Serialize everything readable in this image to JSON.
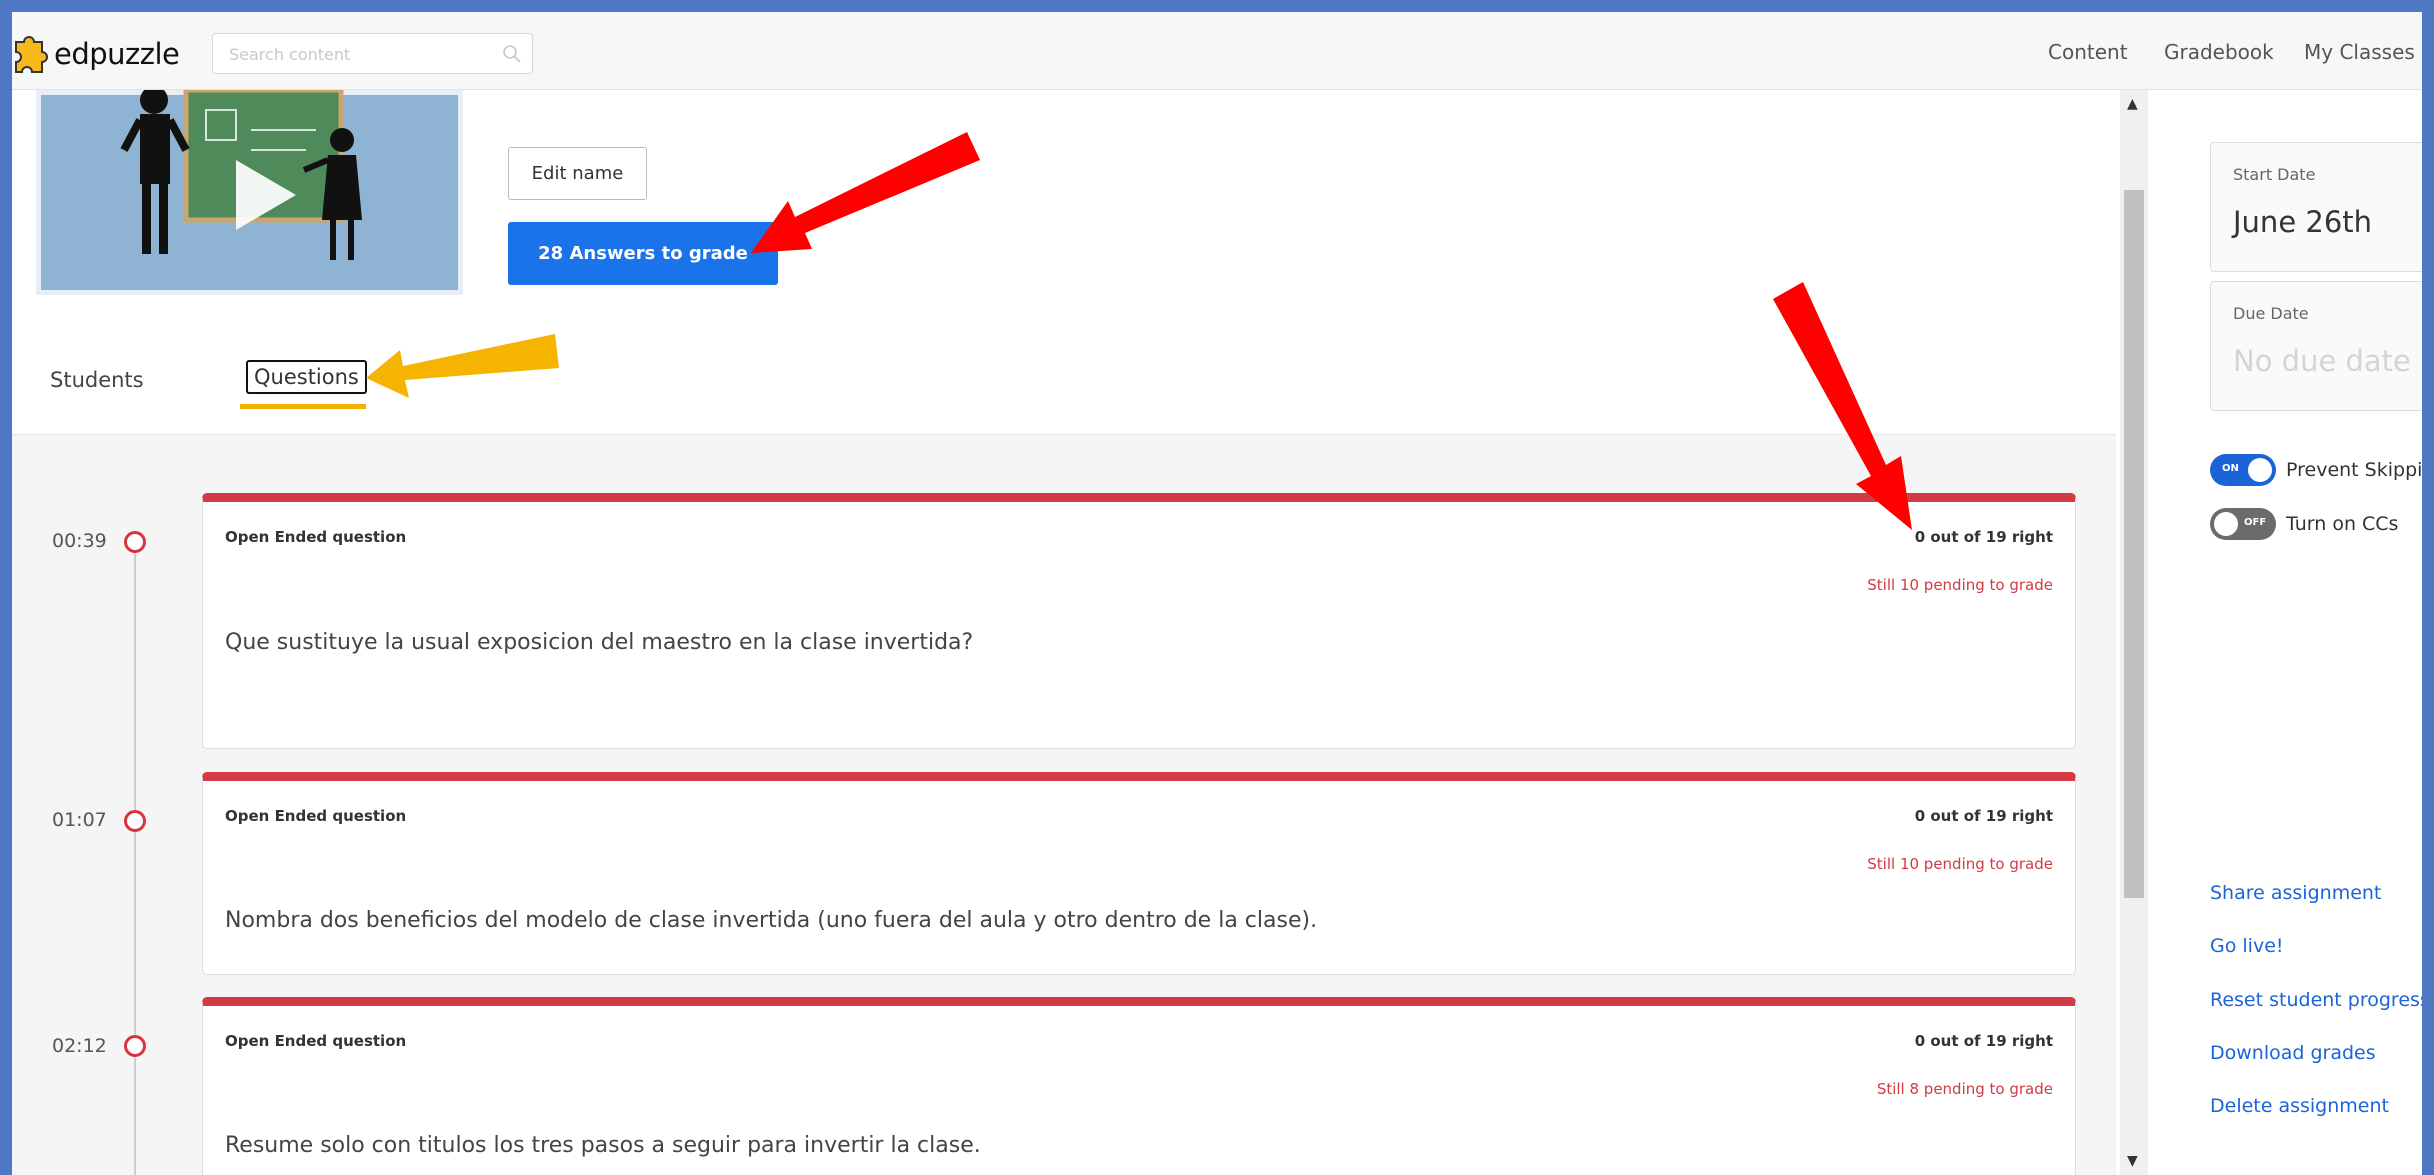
{
  "header": {
    "logo_text": "edpuzzle",
    "search_placeholder": "Search content",
    "nav": [
      "Content",
      "Gradebook",
      "My Classes"
    ]
  },
  "assignment": {
    "edit_name_label": "Edit name",
    "answers_to_grade_label": "28 Answers to grade"
  },
  "tabs": {
    "students": "Students",
    "questions": "Questions",
    "active": "Questions"
  },
  "questions": [
    {
      "time": "00:39",
      "type": "Open Ended question",
      "score": "0 out of 19 right",
      "pending": "Still 10 pending to grade",
      "text": "Que sustituye la usual exposicion del maestro en la clase invertida?"
    },
    {
      "time": "01:07",
      "type": "Open Ended question",
      "score": "0 out of 19 right",
      "pending": "Still 10 pending to grade",
      "text": "Nombra dos beneficios del modelo de clase invertida (uno fuera del aula y otro dentro de la clase)."
    },
    {
      "time": "02:12",
      "type": "Open Ended question",
      "score": "0 out of 19 right",
      "pending": "Still 8 pending to grade",
      "text": "Resume solo con titulos los tres pasos a seguir para invertir la clase."
    }
  ],
  "side_panel": {
    "start_date_label": "Start Date",
    "start_date_value": "June 26th",
    "due_date_label": "Due Date",
    "due_date_value": "No due date",
    "toggles": [
      {
        "label": "Prevent Skipping",
        "state_text": "ON",
        "on": true
      },
      {
        "label": "Turn on CCs",
        "state_text": "OFF",
        "on": false
      }
    ],
    "actions": [
      "Share assignment",
      "Go live!",
      "Reset student progress",
      "Download grades",
      "Delete assignment"
    ]
  },
  "colors": {
    "primary_blue": "#1a73e8",
    "accent_red": "#d33a44",
    "tab_underline": "#f5b100",
    "annotation_red": "#ff0000",
    "annotation_yellow": "#f5b400"
  },
  "icons": {
    "logo": "puzzle-piece-icon",
    "search": "search-icon",
    "play": "play-icon"
  }
}
